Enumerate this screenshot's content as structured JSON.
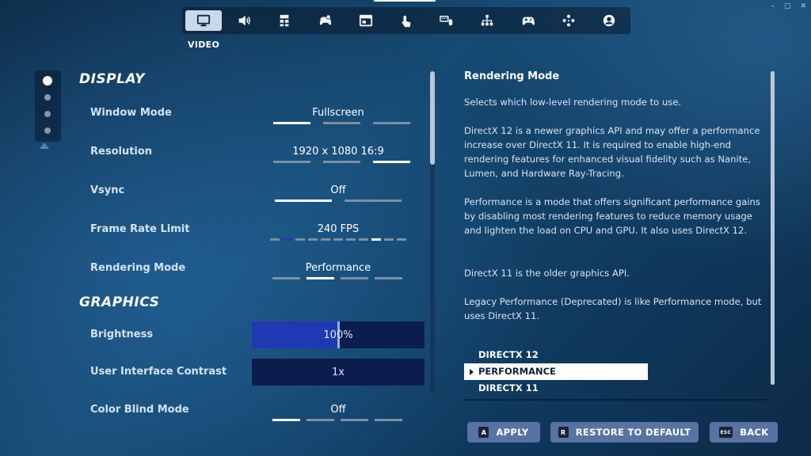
{
  "nav": {
    "tabs": [
      {
        "icon": "monitor-icon",
        "active": true
      },
      {
        "icon": "speaker-icon"
      },
      {
        "icon": "accessibility-grid-icon"
      },
      {
        "icon": "controller-settings-icon"
      },
      {
        "icon": "window-layout-icon"
      },
      {
        "icon": "touch-icon"
      },
      {
        "icon": "keyboard-mouse-icon"
      },
      {
        "icon": "network-nodes-icon"
      },
      {
        "icon": "gamepad-icon"
      },
      {
        "icon": "gamepad-layout-icon"
      },
      {
        "icon": "account-icon"
      }
    ],
    "active_label": "VIDEO"
  },
  "window_controls": {
    "minimize": "–",
    "maximize": "▢",
    "close": "✕"
  },
  "rail": {
    "sections": 4,
    "active_index": 0
  },
  "display": {
    "title": "DISPLAY",
    "window_mode": {
      "label": "Window Mode",
      "value": "Fullscreen",
      "options_count": 3,
      "selected_index": 0
    },
    "resolution": {
      "label": "Resolution",
      "value": "1920 x 1080 16:9",
      "options_count": 3,
      "selected_index": 2
    },
    "vsync": {
      "label": "Vsync",
      "value": "Off",
      "options_count": 2,
      "selected_index": 0
    },
    "frame_rate": {
      "label": "Frame Rate Limit",
      "value": "240 FPS",
      "options_count": 11,
      "selected_index": 8
    },
    "rendering_mode": {
      "label": "Rendering Mode",
      "value": "Performance",
      "options_count": 4,
      "selected_index": 1
    }
  },
  "graphics": {
    "title": "GRAPHICS",
    "brightness": {
      "label": "Brightness",
      "value": "100%",
      "level": 0.5
    },
    "ui_contrast": {
      "label": "User Interface Contrast",
      "value": "1x"
    },
    "color_blind": {
      "label": "Color Blind Mode",
      "value": "Off",
      "options_count": 4,
      "selected_index": 0
    }
  },
  "details": {
    "title": "Rendering Mode",
    "paragraphs": [
      "Selects which low-level rendering mode to use.",
      "DirectX 12 is a newer graphics API and may offer a performance increase over DirectX 11. It is required to enable high-end rendering features for enhanced visual fidelity such as Nanite, Lumen, and Hardware Ray-Tracing.",
      "Performance is a mode that offers significant performance gains by disabling most rendering features to reduce memory usage and lighten the load on CPU and GPU. It also uses DirectX 12.",
      "DirectX 11 is the older graphics API.",
      "Legacy Performance (Deprecated) is like Performance mode, but uses DirectX 11."
    ],
    "options": [
      "DIRECTX 12",
      "PERFORMANCE",
      "DIRECTX 11"
    ],
    "selected_option": 1
  },
  "buttons": {
    "apply": {
      "key": "A",
      "label": "APPLY"
    },
    "restore": {
      "key": "R",
      "label": "RESTORE TO DEFAULT"
    },
    "back": {
      "key": "ESC",
      "label": "BACK"
    }
  },
  "colors": {
    "accent_blue": "#1f3ab0",
    "button": "#5873a3",
    "selected_tab": "#c9d8ea"
  }
}
